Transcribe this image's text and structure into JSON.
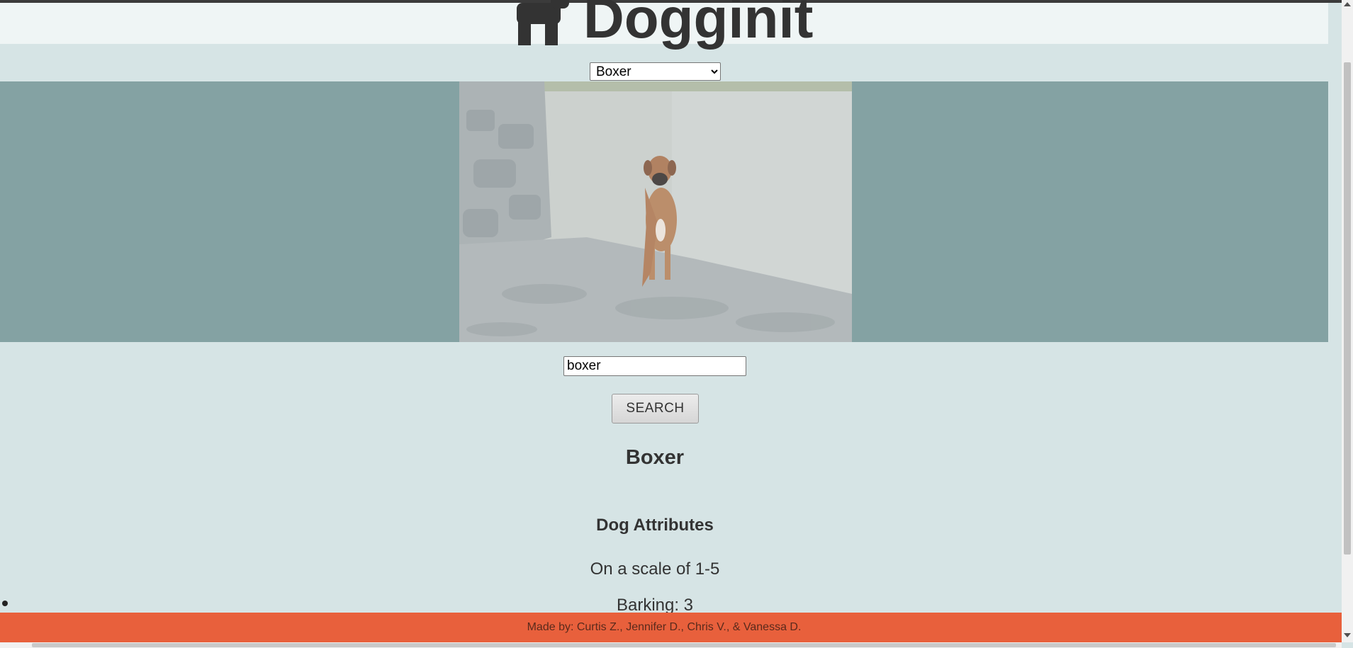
{
  "app": {
    "brand_name": "Dogginit",
    "brand_icon": "dog-icon"
  },
  "breed_select": {
    "selected": "Boxer",
    "options": [
      "Boxer"
    ]
  },
  "photo": {
    "description_icon": "dog-photo"
  },
  "search": {
    "value": "boxer",
    "button_label": "SEARCH"
  },
  "result": {
    "breed_name": "Boxer",
    "attributes_heading": "Dog Attributes",
    "scale_note": "On a scale of 1-5",
    "attributes": [
      {
        "label": "Barking: 3"
      }
    ]
  },
  "footer": {
    "credits": "Made by: Curtis Z., Jennifer D., Chris V., & Vanessa D."
  },
  "colors": {
    "page_bg": "#d6e4e5",
    "header_bg": "#eff5f5",
    "hero_bg": "#84a2a3",
    "footer_bg": "#e8603c",
    "text": "#333333"
  }
}
